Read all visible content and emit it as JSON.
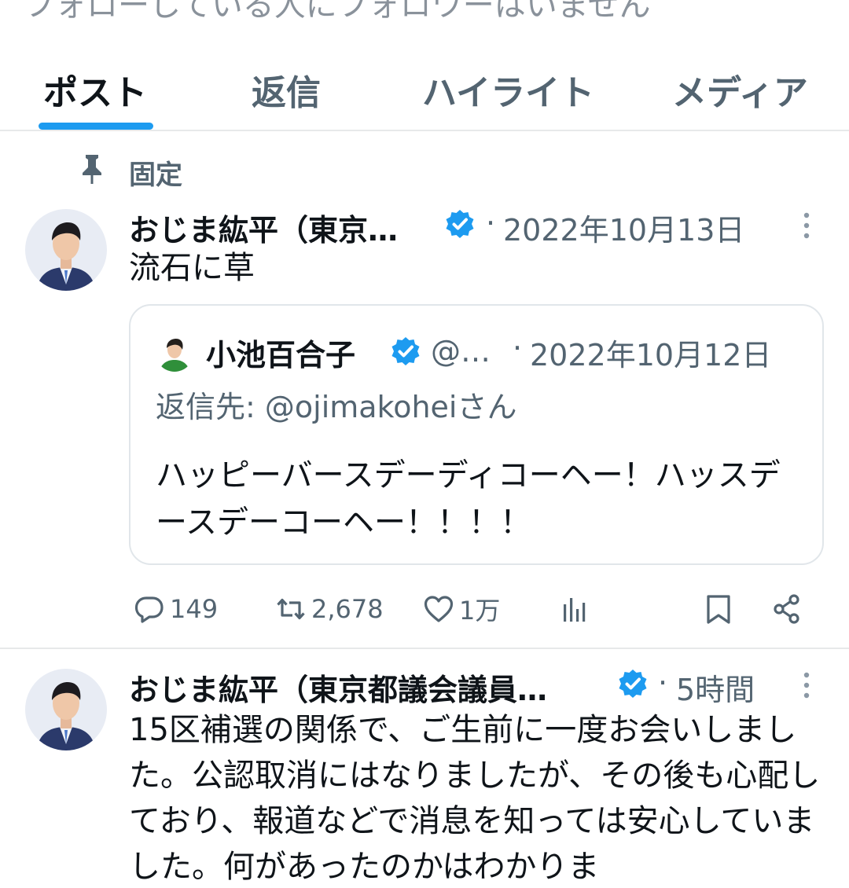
{
  "header": {
    "cut_text": "フォローしている人にフォロワーはいません"
  },
  "tabs": [
    {
      "label": "ポスト",
      "active": true
    },
    {
      "label": "返信",
      "active": false
    },
    {
      "label": "ハイライト",
      "active": false
    },
    {
      "label": "メディア",
      "active": false
    }
  ],
  "pinned": {
    "label": "固定"
  },
  "posts": [
    {
      "author": "おじま紘平（東京…",
      "separator": "·",
      "date": "2022年10月13日",
      "text": "流石に草",
      "quote": {
        "author": "小池百合子",
        "handle": "@…",
        "separator": "·",
        "date": "2022年10月12日",
        "reply_to": "返信先: @ojimakoheiさん",
        "text": "ハッピーバースデーディコーヘー！ハッスデースデーコーヘー！！！！"
      },
      "actions": {
        "replies": "149",
        "reposts": "2,678",
        "likes": "1万"
      }
    },
    {
      "author": "おじま紘平（東京都議会議員…",
      "separator": "·",
      "date": "5時間",
      "text": "15区補選の関係で、ご生前に一度お会いしました。公認取消にはなりましたが、その後も心配しており、報道などで消息を知っては安心していました。何があったのかはわかりま"
    }
  ],
  "colors": {
    "accent": "#1d9bf0",
    "secondary_text": "#536471",
    "border": "#e7e9ea"
  }
}
